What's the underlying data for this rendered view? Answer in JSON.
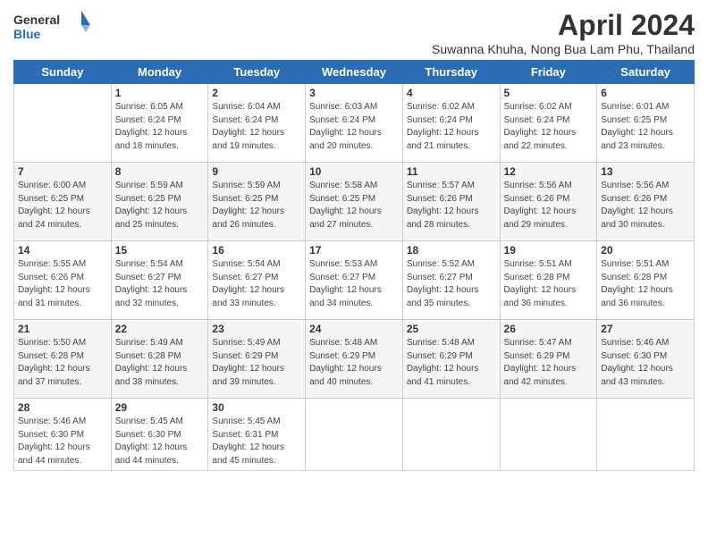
{
  "header": {
    "logo_line1": "General",
    "logo_line2": "Blue",
    "month_title": "April 2024",
    "subtitle": "Suwanna Khuha, Nong Bua Lam Phu, Thailand"
  },
  "days_of_week": [
    "Sunday",
    "Monday",
    "Tuesday",
    "Wednesday",
    "Thursday",
    "Friday",
    "Saturday"
  ],
  "weeks": [
    [
      {
        "day": "",
        "info": ""
      },
      {
        "day": "1",
        "info": "Sunrise: 6:05 AM\nSunset: 6:24 PM\nDaylight: 12 hours\nand 18 minutes."
      },
      {
        "day": "2",
        "info": "Sunrise: 6:04 AM\nSunset: 6:24 PM\nDaylight: 12 hours\nand 19 minutes."
      },
      {
        "day": "3",
        "info": "Sunrise: 6:03 AM\nSunset: 6:24 PM\nDaylight: 12 hours\nand 20 minutes."
      },
      {
        "day": "4",
        "info": "Sunrise: 6:02 AM\nSunset: 6:24 PM\nDaylight: 12 hours\nand 21 minutes."
      },
      {
        "day": "5",
        "info": "Sunrise: 6:02 AM\nSunset: 6:24 PM\nDaylight: 12 hours\nand 22 minutes."
      },
      {
        "day": "6",
        "info": "Sunrise: 6:01 AM\nSunset: 6:25 PM\nDaylight: 12 hours\nand 23 minutes."
      }
    ],
    [
      {
        "day": "7",
        "info": "Sunrise: 6:00 AM\nSunset: 6:25 PM\nDaylight: 12 hours\nand 24 minutes."
      },
      {
        "day": "8",
        "info": "Sunrise: 5:59 AM\nSunset: 6:25 PM\nDaylight: 12 hours\nand 25 minutes."
      },
      {
        "day": "9",
        "info": "Sunrise: 5:59 AM\nSunset: 6:25 PM\nDaylight: 12 hours\nand 26 minutes."
      },
      {
        "day": "10",
        "info": "Sunrise: 5:58 AM\nSunset: 6:25 PM\nDaylight: 12 hours\nand 27 minutes."
      },
      {
        "day": "11",
        "info": "Sunrise: 5:57 AM\nSunset: 6:26 PM\nDaylight: 12 hours\nand 28 minutes."
      },
      {
        "day": "12",
        "info": "Sunrise: 5:56 AM\nSunset: 6:26 PM\nDaylight: 12 hours\nand 29 minutes."
      },
      {
        "day": "13",
        "info": "Sunrise: 5:56 AM\nSunset: 6:26 PM\nDaylight: 12 hours\nand 30 minutes."
      }
    ],
    [
      {
        "day": "14",
        "info": "Sunrise: 5:55 AM\nSunset: 6:26 PM\nDaylight: 12 hours\nand 31 minutes."
      },
      {
        "day": "15",
        "info": "Sunrise: 5:54 AM\nSunset: 6:27 PM\nDaylight: 12 hours\nand 32 minutes."
      },
      {
        "day": "16",
        "info": "Sunrise: 5:54 AM\nSunset: 6:27 PM\nDaylight: 12 hours\nand 33 minutes."
      },
      {
        "day": "17",
        "info": "Sunrise: 5:53 AM\nSunset: 6:27 PM\nDaylight: 12 hours\nand 34 minutes."
      },
      {
        "day": "18",
        "info": "Sunrise: 5:52 AM\nSunset: 6:27 PM\nDaylight: 12 hours\nand 35 minutes."
      },
      {
        "day": "19",
        "info": "Sunrise: 5:51 AM\nSunset: 6:28 PM\nDaylight: 12 hours\nand 36 minutes."
      },
      {
        "day": "20",
        "info": "Sunrise: 5:51 AM\nSunset: 6:28 PM\nDaylight: 12 hours\nand 36 minutes."
      }
    ],
    [
      {
        "day": "21",
        "info": "Sunrise: 5:50 AM\nSunset: 6:28 PM\nDaylight: 12 hours\nand 37 minutes."
      },
      {
        "day": "22",
        "info": "Sunrise: 5:49 AM\nSunset: 6:28 PM\nDaylight: 12 hours\nand 38 minutes."
      },
      {
        "day": "23",
        "info": "Sunrise: 5:49 AM\nSunset: 6:29 PM\nDaylight: 12 hours\nand 39 minutes."
      },
      {
        "day": "24",
        "info": "Sunrise: 5:48 AM\nSunset: 6:29 PM\nDaylight: 12 hours\nand 40 minutes."
      },
      {
        "day": "25",
        "info": "Sunrise: 5:48 AM\nSunset: 6:29 PM\nDaylight: 12 hours\nand 41 minutes."
      },
      {
        "day": "26",
        "info": "Sunrise: 5:47 AM\nSunset: 6:29 PM\nDaylight: 12 hours\nand 42 minutes."
      },
      {
        "day": "27",
        "info": "Sunrise: 5:46 AM\nSunset: 6:30 PM\nDaylight: 12 hours\nand 43 minutes."
      }
    ],
    [
      {
        "day": "28",
        "info": "Sunrise: 5:46 AM\nSunset: 6:30 PM\nDaylight: 12 hours\nand 44 minutes."
      },
      {
        "day": "29",
        "info": "Sunrise: 5:45 AM\nSunset: 6:30 PM\nDaylight: 12 hours\nand 44 minutes."
      },
      {
        "day": "30",
        "info": "Sunrise: 5:45 AM\nSunset: 6:31 PM\nDaylight: 12 hours\nand 45 minutes."
      },
      {
        "day": "",
        "info": ""
      },
      {
        "day": "",
        "info": ""
      },
      {
        "day": "",
        "info": ""
      },
      {
        "day": "",
        "info": ""
      }
    ]
  ]
}
